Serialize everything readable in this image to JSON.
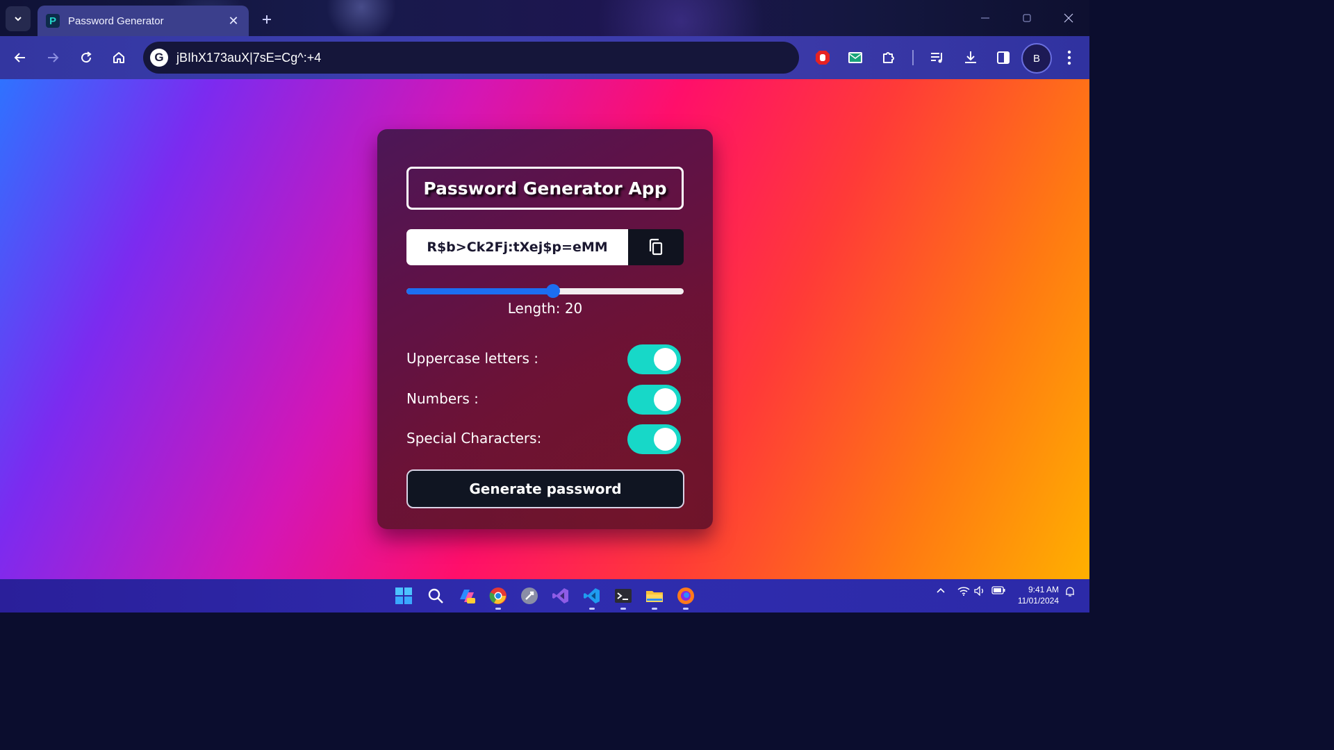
{
  "browser": {
    "tab_title": "Password Generator",
    "tab_close": "✕",
    "new_tab": "+",
    "address": "jBIhX173auX|7sE=Cg^:+4",
    "avatar_initial": "B",
    "favicon_letter": "P",
    "omnibox_icon_letter": "G"
  },
  "app": {
    "title": "Password Generator App",
    "password": "R$b>Ck2Fj:tXej$p=eMM",
    "length_label": "Length: 20",
    "length_value": 20,
    "length_fraction": 0.53,
    "options": [
      {
        "label": "Uppercase letters :",
        "enabled": true
      },
      {
        "label": "Numbers :",
        "enabled": true
      },
      {
        "label": "Special Characters:",
        "enabled": true
      }
    ],
    "generate_label": "Generate password",
    "colors": {
      "slider": "#1c6ef2",
      "toggle": "#17d8c8",
      "button": "#101522"
    }
  },
  "taskbar": {
    "apps": [
      "windows-start",
      "search",
      "copilot",
      "chrome",
      "rocket",
      "visual-studio",
      "vscode",
      "terminal",
      "file-explorer",
      "firefox"
    ],
    "time": "9:41 AM",
    "date": "11/01/2024"
  }
}
